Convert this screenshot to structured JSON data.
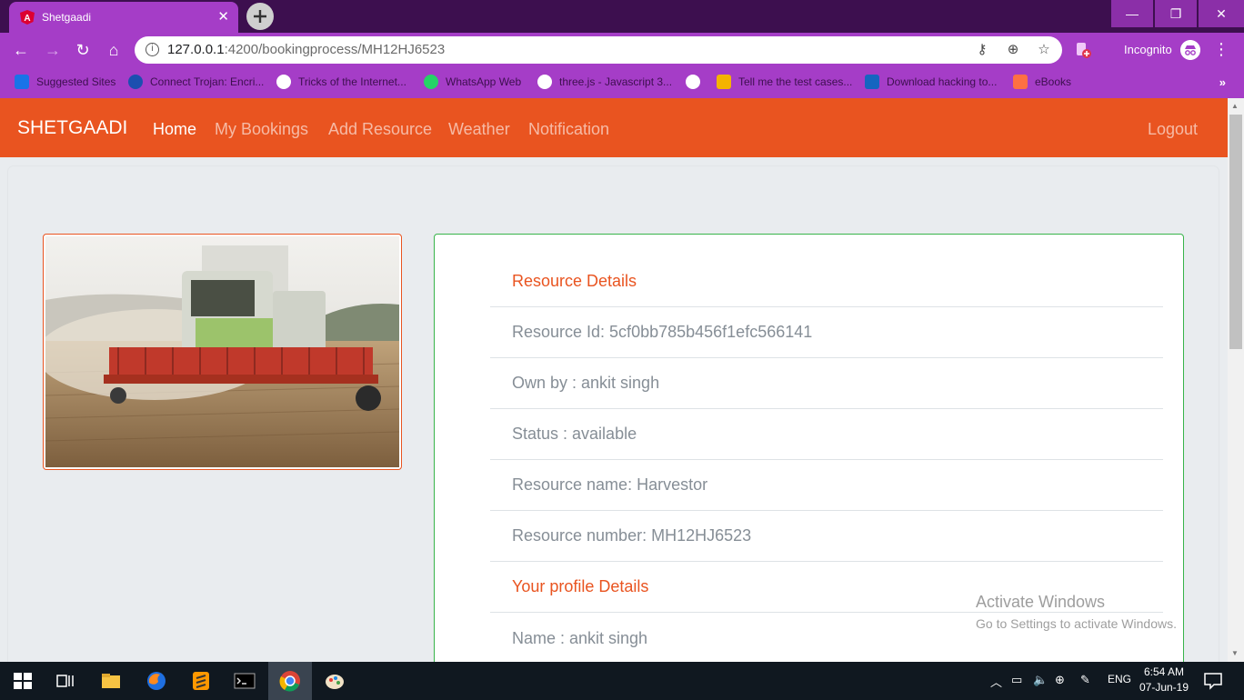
{
  "browser": {
    "tab_title": "Shetgaadi",
    "url_host": "127.0.0.1",
    "url_path": ":4200/bookingprocess/MH12HJ6523",
    "incognito_label": "Incognito",
    "bookmarks": [
      {
        "label": "Suggested Sites",
        "icon": "bing-icon",
        "color": "#1a73e8"
      },
      {
        "label": "Connect Trojan: Encri...",
        "icon": "connect-icon",
        "color": "#1c4fb0"
      },
      {
        "label": "Tricks of the Internet...",
        "icon": "globe-icon",
        "color": "#ffffff"
      },
      {
        "label": "WhatsApp Web",
        "icon": "whatsapp-icon",
        "color": "#25d366"
      },
      {
        "label": "three.js - Javascript 3...",
        "icon": "globe-icon",
        "color": "#ffffff"
      },
      {
        "label": "",
        "icon": "globe-icon",
        "color": "#ffffff"
      },
      {
        "label": "Tell me the test cases...",
        "icon": "drive-icon",
        "color": "#f4b400"
      },
      {
        "label": "Download hacking to...",
        "icon": "s-icon",
        "color": "#1565c0"
      },
      {
        "label": "eBooks",
        "icon": "ebooks-icon",
        "color": "#ff7043"
      }
    ]
  },
  "navbar": {
    "brand": "SHETGAADI",
    "links": [
      "Home",
      "My Bookings",
      "Add Resource",
      "Weather",
      "Notification"
    ],
    "logout": "Logout"
  },
  "details": {
    "resource_heading": "Resource Details",
    "resource_id": "Resource Id: 5cf0bb785b456f1efc566141",
    "owner": "Own by : ankit singh",
    "status": "Status : available",
    "resource_name": "Resource name: Harvestor",
    "resource_number": "Resource number: MH12HJ6523",
    "profile_heading": "Your profile Details",
    "profile_name": "Name : ankit singh"
  },
  "watermark": {
    "title": "Activate Windows",
    "subtitle": "Go to Settings to activate Windows."
  },
  "taskbar": {
    "language": "ENG",
    "time": "6:54 AM",
    "date": "07-Jun-19"
  },
  "colors": {
    "navbar": "#e95420",
    "card_border": "#38b44a",
    "chrome": "#a53dc7"
  }
}
